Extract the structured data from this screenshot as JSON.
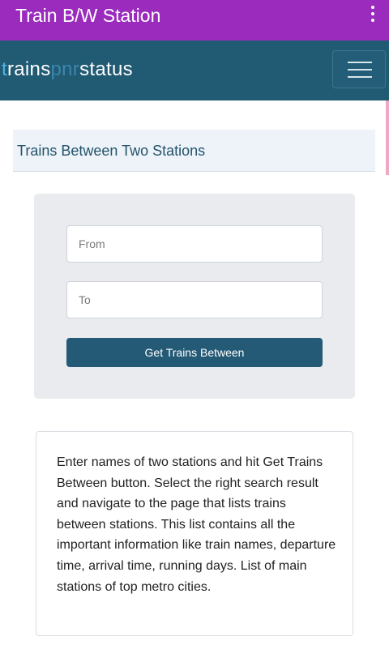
{
  "appbar": {
    "title": "Train B/W Station",
    "overflow_icon": "more-vert-icon"
  },
  "site": {
    "logo_first_letter": "t",
    "logo_rest1": "rains",
    "logo_mid": "pnr",
    "logo_end": "status",
    "menu_icon": "hamburger-menu-icon"
  },
  "section": {
    "title": "Trains Between Two Stations"
  },
  "form": {
    "from_placeholder": "From",
    "from_value": "",
    "to_placeholder": "To",
    "to_value": "",
    "submit_label": "Get Trains Between"
  },
  "info": {
    "text": "Enter names of two stations and hit Get Trains Between button. Select the right search result and navigate to the page that lists trains between stations. This list contains all the important information like train names, departure time, arrival time, running days. List of main stations of top metro cities."
  },
  "colors": {
    "appbar": "#9a2bbd",
    "site_header": "#215a73",
    "button": "#245a76",
    "logo_accent": "#4fb2e6"
  }
}
